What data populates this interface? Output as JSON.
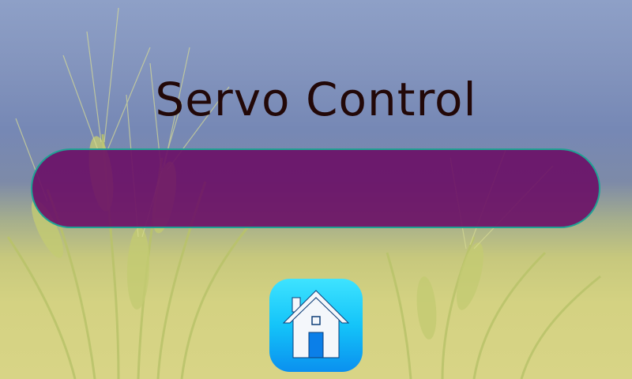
{
  "screen": {
    "title": "Servo Control"
  },
  "controls": {
    "servo_slider": {
      "value": null
    },
    "home_button": {
      "icon": "home-icon"
    }
  },
  "colors": {
    "title_text": "#220808",
    "slider_fill": "#6a0e66",
    "slider_border": "#1fa294",
    "home_button_top": "#3ee3ff",
    "home_button_bottom": "#0a90ef",
    "sky": "#7688b5",
    "field": "#d4d282"
  }
}
